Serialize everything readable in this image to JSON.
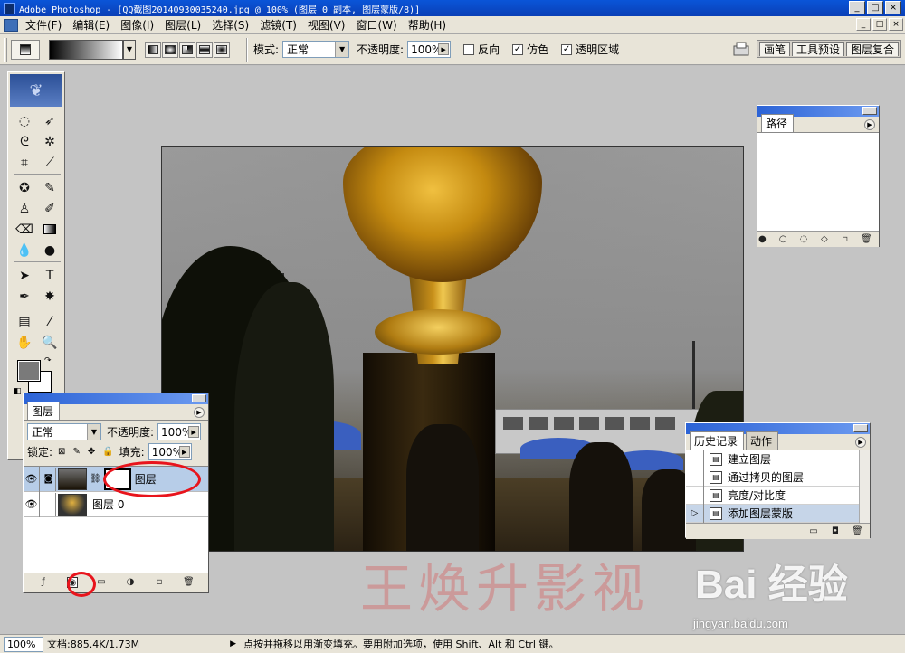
{
  "window": {
    "title": "Adobe Photoshop - [QQ截图20140930035240.jpg @ 100% (图层 0 副本, 图层蒙版/8)]",
    "controls": [
      "_",
      "□",
      "×"
    ]
  },
  "menu": {
    "items": [
      "文件(F)",
      "编辑(E)",
      "图像(I)",
      "图层(L)",
      "选择(S)",
      "滤镜(T)",
      "视图(V)",
      "窗口(W)",
      "帮助(H)"
    ],
    "doc_controls": [
      "_",
      "□",
      "×"
    ]
  },
  "options": {
    "mode_label": "模式:",
    "mode_value": "正常",
    "opacity_label": "不透明度:",
    "opacity_value": "100%",
    "reverse_label": "反向",
    "dither_label": "仿色",
    "transparency_label": "透明区域",
    "reverse_checked": "",
    "dither_checked": "✓",
    "transparency_checked": "✓",
    "well_tabs": [
      "画笔",
      "工具预设",
      "图层复合"
    ]
  },
  "colors": {
    "foreground": "#7a7a7a",
    "background": "#ffffff",
    "title_bar": "#0a55d8",
    "selection_highlight": "#b7cde8",
    "annotation_red": "#e8141c"
  },
  "layers": {
    "tab": "图层",
    "blend_mode": "正常",
    "opacity_label": "不透明度:",
    "opacity_value": "100%",
    "lock_label": "锁定:",
    "fill_label": "填充:",
    "fill_value": "100%",
    "rows": [
      {
        "name": "图层",
        "selected": true,
        "has_mask": true
      },
      {
        "name": "图层 0",
        "selected": false,
        "has_mask": false
      }
    ]
  },
  "paths": {
    "tab": "路径"
  },
  "history": {
    "tabs": [
      "历史记录",
      "动作"
    ],
    "items": [
      "建立图层",
      "通过拷贝的图层",
      "亮度/对比度",
      "添加图层蒙版"
    ]
  },
  "watermark": {
    "author": "王焕升影视",
    "brand": "Bai 经验",
    "url": "jingyan.baidu.com"
  },
  "status": {
    "zoom": "100%",
    "doc": "文档:885.4K/1.73M",
    "hint": "点按并拖移以用渐变填充。要用附加选项，使用 Shift、Alt 和 Ctrl 键。"
  }
}
